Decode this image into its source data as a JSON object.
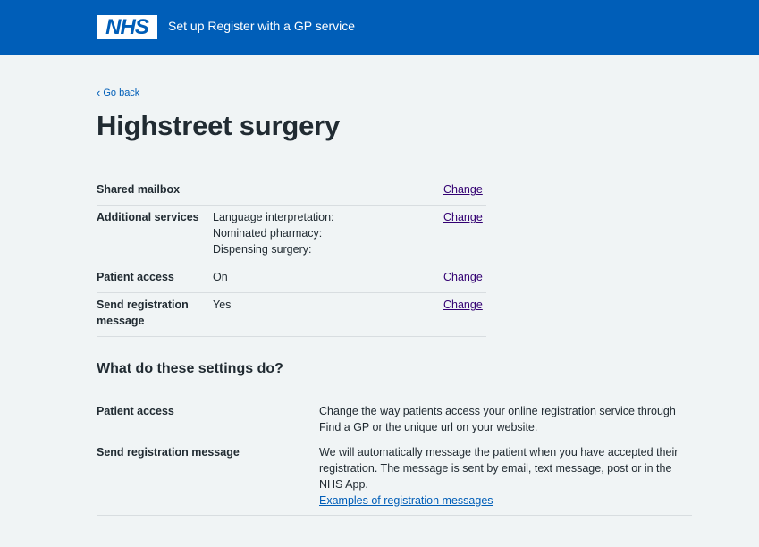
{
  "header": {
    "logo_text": "NHS",
    "service_name": "Set up Register with a GP service"
  },
  "back_link": {
    "label": "Go back"
  },
  "page_title": "Highstreet surgery",
  "summary": {
    "rows": [
      {
        "key": "Shared mailbox",
        "value_lines": [],
        "action": "Change"
      },
      {
        "key": "Additional services",
        "value_lines": [
          "Language interpretation:",
          "Nominated pharmacy:",
          "Dispensing surgery:"
        ],
        "action": "Change"
      },
      {
        "key": "Patient access",
        "value_lines": [
          "On"
        ],
        "action": "Change"
      },
      {
        "key": "Send registration message",
        "value_lines": [
          "Yes"
        ],
        "action": "Change"
      }
    ]
  },
  "settings_info": {
    "heading": "What do these settings do?",
    "rows": [
      {
        "key": "Patient access",
        "text": "Change the way patients access your online registration service through Find a GP or the unique url on your website.",
        "link": ""
      },
      {
        "key": "Send registration message",
        "text": "We will automatically message the patient when you have accepted their registration. The message is sent by email, text message, post or in the NHS App.",
        "link": "Examples of registration messages"
      }
    ]
  },
  "colors": {
    "header_bg": "#005eb8",
    "page_bg": "#f0f4f5",
    "text": "#212b32",
    "link": "#005eb8",
    "visited_link": "#330072",
    "border": "#d8dde0"
  }
}
